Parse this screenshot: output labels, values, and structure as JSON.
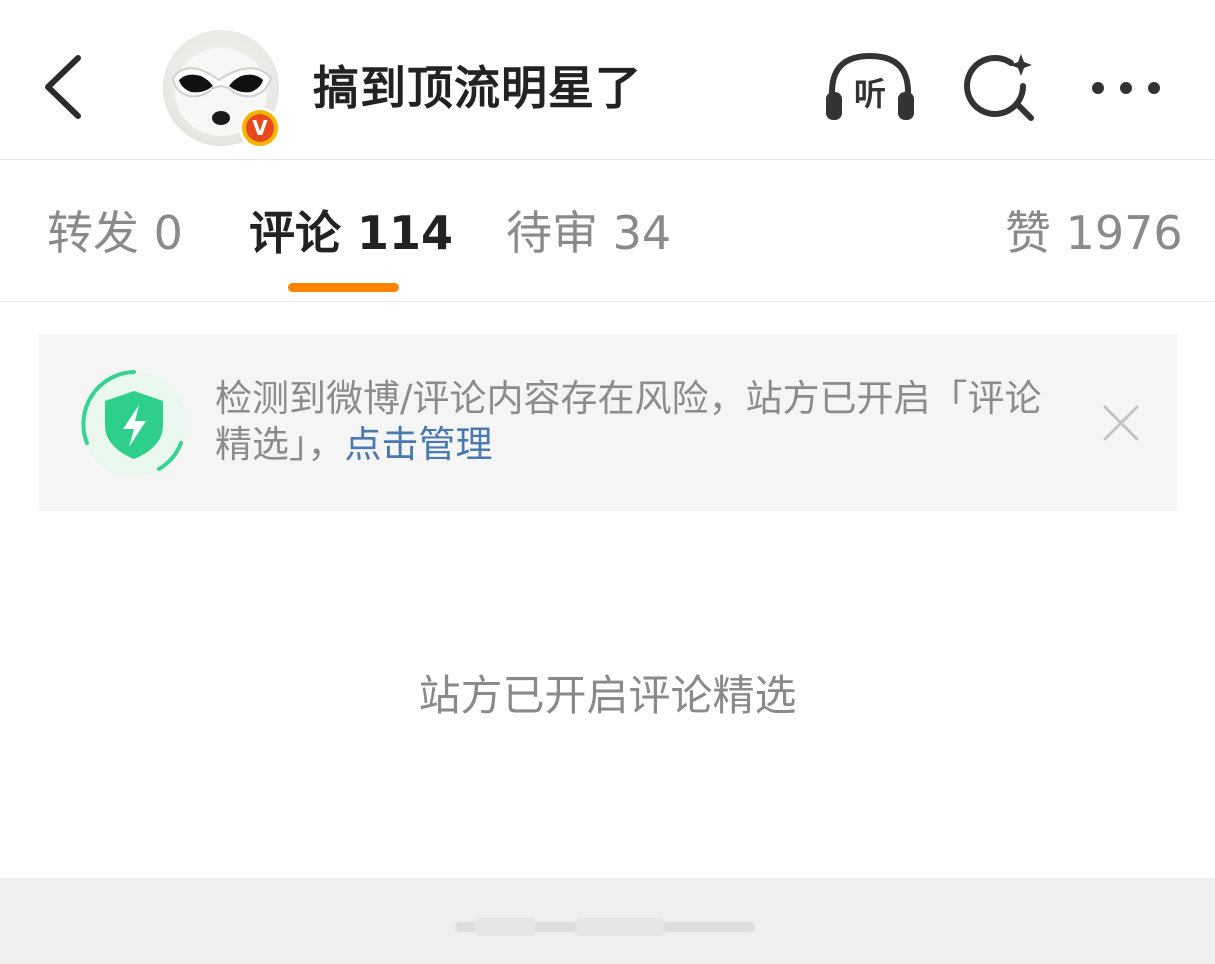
{
  "header": {
    "title": "搞到顶流明星了",
    "listen_label": "听",
    "badge_letter": "V",
    "icons": {
      "back": "chevron-left-icon",
      "listen": "headphones-icon",
      "search": "search-sparkle-icon",
      "more": "more-dots-icon"
    }
  },
  "tabs": [
    {
      "label": "转发 0"
    },
    {
      "label": "评论 114"
    },
    {
      "label": "待审 34"
    },
    {
      "label": "赞 1976"
    }
  ],
  "notice": {
    "text": "检测到微博/评论内容存在风险，站方已开启「评论精选」，",
    "link": "点击管理",
    "icon": "shield-lightning-icon"
  },
  "empty_message": "站方已开启评论精选",
  "colors": {
    "accent": "#ff8200",
    "link": "#4a78b0",
    "shield": "#2ecf8a",
    "badge": "#f5b400"
  }
}
